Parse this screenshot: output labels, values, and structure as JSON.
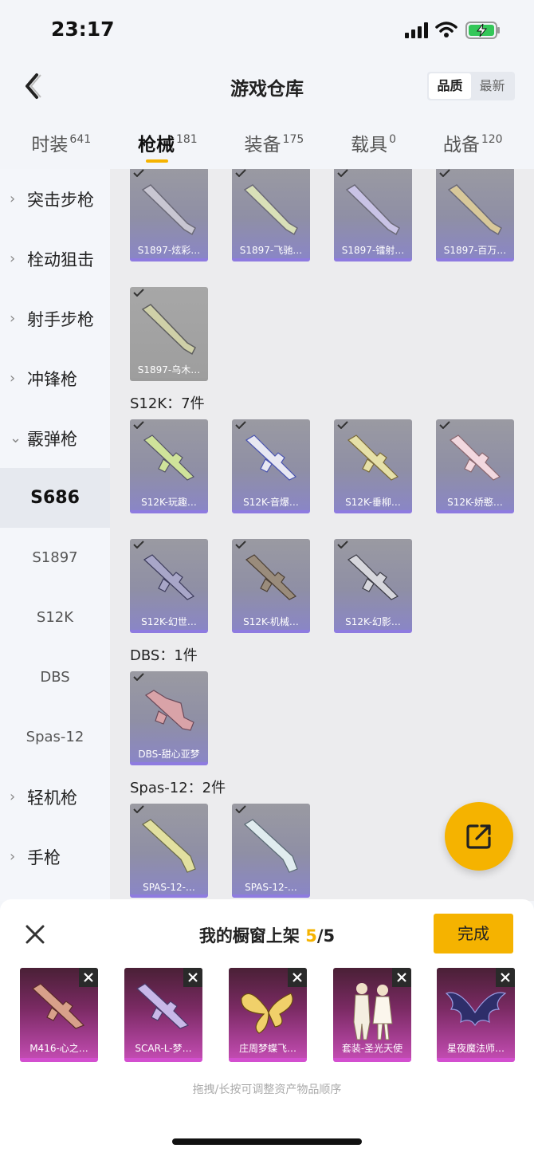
{
  "status": {
    "time": "23:17"
  },
  "header": {
    "title": "游戏仓库",
    "sort_quality": "品质",
    "sort_latest": "最新"
  },
  "tabs": [
    {
      "label": "时装",
      "count": "641"
    },
    {
      "label": "枪械",
      "count": "181"
    },
    {
      "label": "装备",
      "count": "175"
    },
    {
      "label": "载具",
      "count": "0"
    },
    {
      "label": "战备",
      "count": "120"
    }
  ],
  "sidebar": {
    "items": [
      {
        "label": "突击步枪"
      },
      {
        "label": "栓动狙击"
      },
      {
        "label": "射手步枪"
      },
      {
        "label": "冲锋枪"
      },
      {
        "label": "霰弹枪"
      }
    ],
    "subs": [
      {
        "label": "S686"
      },
      {
        "label": "S1897"
      },
      {
        "label": "S12K"
      },
      {
        "label": "DBS"
      },
      {
        "label": "Spas-12"
      }
    ],
    "more": [
      {
        "label": "轻机枪"
      },
      {
        "label": "手枪"
      }
    ]
  },
  "groups": {
    "s1897_row1": [
      "S1897-炫彩…",
      "S1897-飞驰…",
      "S1897-镭射…",
      "S1897-百万…"
    ],
    "s1897_row2": [
      "S1897-乌木…"
    ],
    "s12k_title": "S12K：7件",
    "s12k_row1": [
      "S12K-玩趣…",
      "S12K-音爆…",
      "S12K-垂柳…",
      "S12K-娇憨…"
    ],
    "s12k_row2": [
      "S12K-幻世…",
      "S12K-机械…",
      "S12K-幻影…"
    ],
    "dbs_title": "DBS：1件",
    "dbs_row": [
      "DBS-甜心亚梦"
    ],
    "spas_title": "Spas-12：2件",
    "spas_row": [
      "SPAS-12-…",
      "SPAS-12-…"
    ]
  },
  "sheet": {
    "title": "我的橱窗上架",
    "count": "5",
    "total": "/5",
    "done": "完成",
    "items": [
      "M416-心之…",
      "SCAR-L-梦…",
      "庄周梦蝶飞…",
      "套装-圣光天使",
      "星夜魔法师…"
    ],
    "hint": "拖拽/长按可调整资产物品顺序"
  },
  "colors": {
    "accent": "#f5b300",
    "card_purple": "#8e7be0",
    "shelf_purple": "#c14bb0"
  }
}
